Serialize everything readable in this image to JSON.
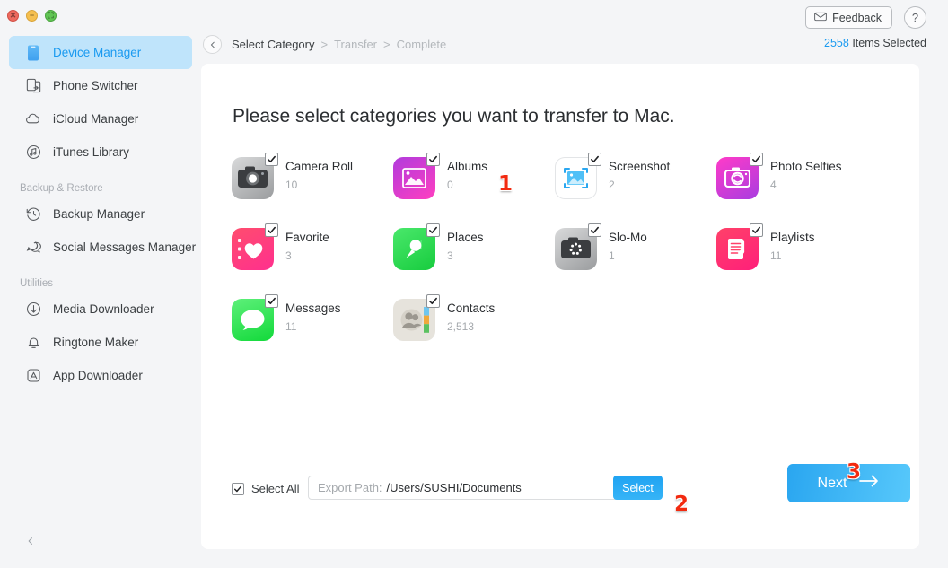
{
  "window": {
    "traffic_lights": [
      "close",
      "minimize",
      "maximize"
    ]
  },
  "sidebar": {
    "items": [
      {
        "label": "Device Manager",
        "icon": "device-icon",
        "active": true
      },
      {
        "label": "Phone Switcher",
        "icon": "phone-switcher-icon",
        "active": false
      },
      {
        "label": "iCloud Manager",
        "icon": "icloud-icon",
        "active": false
      },
      {
        "label": "iTunes Library",
        "icon": "itunes-icon",
        "active": false
      }
    ],
    "section_backup": "Backup & Restore",
    "backup_items": [
      {
        "label": "Backup Manager",
        "icon": "backup-clock-icon"
      },
      {
        "label": "Social Messages Manager",
        "icon": "chat-bubbles-icon"
      }
    ],
    "section_utilities": "Utilities",
    "utility_items": [
      {
        "label": "Media Downloader",
        "icon": "download-arrow-icon"
      },
      {
        "label": "Ringtone Maker",
        "icon": "bell-icon"
      },
      {
        "label": "App Downloader",
        "icon": "appstore-icon"
      }
    ],
    "collapse_icon": "chevron-left-icon"
  },
  "header": {
    "back_icon": "chevron-left-icon",
    "breadcrumb": {
      "current": "Select Category",
      "sep1": ">",
      "step2": "Transfer",
      "sep2": ">",
      "step3": "Complete"
    },
    "feedback_label": "Feedback",
    "feedback_icon": "envelope-icon",
    "help_label": "?",
    "items_count": "2558",
    "items_suffix": " Items Selected"
  },
  "main": {
    "title": "Please select categories you want to transfer to Mac.",
    "categories": [
      {
        "name": "Camera Roll",
        "count": "10",
        "icon": "camera-roll-icon",
        "checked": true
      },
      {
        "name": "Albums",
        "count": "0",
        "icon": "albums-icon",
        "checked": true
      },
      {
        "name": "Screenshot",
        "count": "2",
        "icon": "screenshot-icon",
        "checked": true
      },
      {
        "name": "Photo Selfies",
        "count": "4",
        "icon": "photo-selfies-icon",
        "checked": true
      },
      {
        "name": "Favorite",
        "count": "3",
        "icon": "favorite-icon",
        "checked": true
      },
      {
        "name": "Places",
        "count": "3",
        "icon": "places-icon",
        "checked": true
      },
      {
        "name": "Slo-Mo",
        "count": "1",
        "icon": "slomo-icon",
        "checked": true
      },
      {
        "name": "Playlists",
        "count": "11",
        "icon": "playlists-icon",
        "checked": true
      },
      {
        "name": "Messages",
        "count": "11",
        "icon": "messages-icon",
        "checked": true
      },
      {
        "name": "Contacts",
        "count": "2,513",
        "icon": "contacts-icon",
        "checked": true
      }
    ]
  },
  "footer": {
    "select_all_label": "Select All",
    "select_all_checked": true,
    "export_path_placeholder": "Export Path:",
    "export_path_value": "/Users/SUSHI/Documents",
    "select_button_label": "Select",
    "next_button_label": "Next",
    "next_button_icon": "arrow-right-icon"
  },
  "annotations": [
    {
      "label": "1"
    },
    {
      "label": "2"
    },
    {
      "label": "3"
    }
  ],
  "colors": {
    "accent": "#1a9af0",
    "sidebar_active_bg": "#bfe4fb",
    "marker_red": "#f22a10",
    "page_bg": "#f4f5f7"
  }
}
